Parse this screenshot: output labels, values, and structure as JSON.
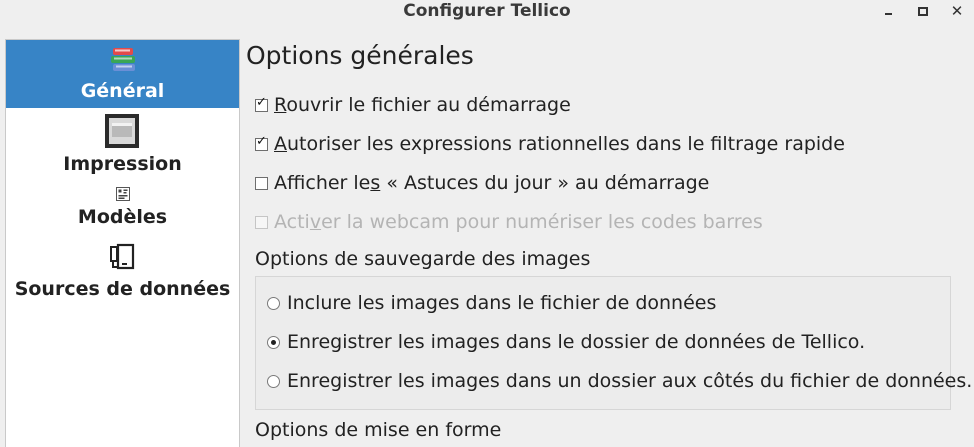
{
  "window": {
    "title": "Configurer Tellico",
    "controls": {
      "minimize": "minimize",
      "maximize": "maximize",
      "close": "close"
    }
  },
  "sidebar": {
    "items": [
      {
        "label": "Général",
        "icon": "books-icon",
        "active": true
      },
      {
        "label": "Impression",
        "icon": "printer-icon",
        "active": false
      },
      {
        "label": "Modèles",
        "icon": "template-icon",
        "active": false
      },
      {
        "label": "Sources de données",
        "icon": "data-source-icon",
        "active": false
      }
    ]
  },
  "main": {
    "heading": "Options générales",
    "checkboxes": [
      {
        "pre": "",
        "accel": "R",
        "post": "ouvrir le fichier au démarrage",
        "checked": true,
        "disabled": false
      },
      {
        "pre": "",
        "accel": "A",
        "post": "utoriser les expressions rationnelles dans le filtrage rapide",
        "checked": true,
        "disabled": false
      },
      {
        "pre": "Afficher le",
        "accel": "s",
        "post": " « Astuces du jour » au démarrage",
        "checked": false,
        "disabled": false
      },
      {
        "pre": "Acti",
        "accel": "v",
        "post": "er la webcam pour numériser les codes barres",
        "checked": false,
        "disabled": true
      }
    ],
    "image_options": {
      "label": "Options de sauvegarde des images",
      "radios": [
        {
          "label": "Inclure les images dans le fichier de données",
          "selected": false
        },
        {
          "label": "Enregistrer les images dans le dossier de données de Tellico.",
          "selected": true
        },
        {
          "label": "Enregistrer les images dans un dossier aux côtés du fichier de données.",
          "selected": false
        }
      ]
    },
    "format_options": {
      "label": "Options de mise en forme"
    }
  },
  "colors": {
    "selection": "#3784c6",
    "background": "#efefef",
    "disabled_text": "#b4b4b4"
  }
}
